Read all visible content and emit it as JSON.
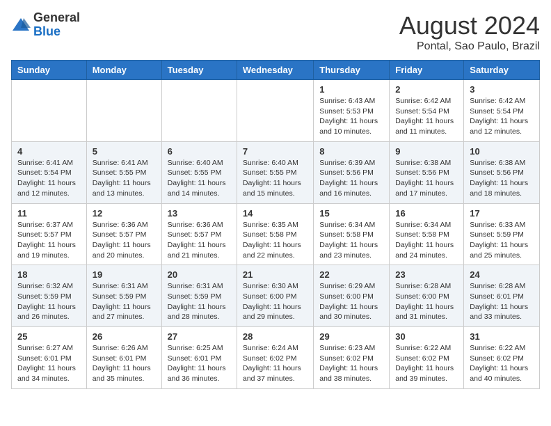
{
  "header": {
    "logo_general": "General",
    "logo_blue": "Blue",
    "month_title": "August 2024",
    "location": "Pontal, Sao Paulo, Brazil"
  },
  "days_of_week": [
    "Sunday",
    "Monday",
    "Tuesday",
    "Wednesday",
    "Thursday",
    "Friday",
    "Saturday"
  ],
  "weeks": [
    [
      {
        "day": "",
        "info": ""
      },
      {
        "day": "",
        "info": ""
      },
      {
        "day": "",
        "info": ""
      },
      {
        "day": "",
        "info": ""
      },
      {
        "day": "1",
        "info": "Sunrise: 6:43 AM\nSunset: 5:53 PM\nDaylight: 11 hours and 10 minutes."
      },
      {
        "day": "2",
        "info": "Sunrise: 6:42 AM\nSunset: 5:54 PM\nDaylight: 11 hours and 11 minutes."
      },
      {
        "day": "3",
        "info": "Sunrise: 6:42 AM\nSunset: 5:54 PM\nDaylight: 11 hours and 12 minutes."
      }
    ],
    [
      {
        "day": "4",
        "info": "Sunrise: 6:41 AM\nSunset: 5:54 PM\nDaylight: 11 hours and 12 minutes."
      },
      {
        "day": "5",
        "info": "Sunrise: 6:41 AM\nSunset: 5:55 PM\nDaylight: 11 hours and 13 minutes."
      },
      {
        "day": "6",
        "info": "Sunrise: 6:40 AM\nSunset: 5:55 PM\nDaylight: 11 hours and 14 minutes."
      },
      {
        "day": "7",
        "info": "Sunrise: 6:40 AM\nSunset: 5:55 PM\nDaylight: 11 hours and 15 minutes."
      },
      {
        "day": "8",
        "info": "Sunrise: 6:39 AM\nSunset: 5:56 PM\nDaylight: 11 hours and 16 minutes."
      },
      {
        "day": "9",
        "info": "Sunrise: 6:38 AM\nSunset: 5:56 PM\nDaylight: 11 hours and 17 minutes."
      },
      {
        "day": "10",
        "info": "Sunrise: 6:38 AM\nSunset: 5:56 PM\nDaylight: 11 hours and 18 minutes."
      }
    ],
    [
      {
        "day": "11",
        "info": "Sunrise: 6:37 AM\nSunset: 5:57 PM\nDaylight: 11 hours and 19 minutes."
      },
      {
        "day": "12",
        "info": "Sunrise: 6:36 AM\nSunset: 5:57 PM\nDaylight: 11 hours and 20 minutes."
      },
      {
        "day": "13",
        "info": "Sunrise: 6:36 AM\nSunset: 5:57 PM\nDaylight: 11 hours and 21 minutes."
      },
      {
        "day": "14",
        "info": "Sunrise: 6:35 AM\nSunset: 5:58 PM\nDaylight: 11 hours and 22 minutes."
      },
      {
        "day": "15",
        "info": "Sunrise: 6:34 AM\nSunset: 5:58 PM\nDaylight: 11 hours and 23 minutes."
      },
      {
        "day": "16",
        "info": "Sunrise: 6:34 AM\nSunset: 5:58 PM\nDaylight: 11 hours and 24 minutes."
      },
      {
        "day": "17",
        "info": "Sunrise: 6:33 AM\nSunset: 5:59 PM\nDaylight: 11 hours and 25 minutes."
      }
    ],
    [
      {
        "day": "18",
        "info": "Sunrise: 6:32 AM\nSunset: 5:59 PM\nDaylight: 11 hours and 26 minutes."
      },
      {
        "day": "19",
        "info": "Sunrise: 6:31 AM\nSunset: 5:59 PM\nDaylight: 11 hours and 27 minutes."
      },
      {
        "day": "20",
        "info": "Sunrise: 6:31 AM\nSunset: 5:59 PM\nDaylight: 11 hours and 28 minutes."
      },
      {
        "day": "21",
        "info": "Sunrise: 6:30 AM\nSunset: 6:00 PM\nDaylight: 11 hours and 29 minutes."
      },
      {
        "day": "22",
        "info": "Sunrise: 6:29 AM\nSunset: 6:00 PM\nDaylight: 11 hours and 30 minutes."
      },
      {
        "day": "23",
        "info": "Sunrise: 6:28 AM\nSunset: 6:00 PM\nDaylight: 11 hours and 31 minutes."
      },
      {
        "day": "24",
        "info": "Sunrise: 6:28 AM\nSunset: 6:01 PM\nDaylight: 11 hours and 33 minutes."
      }
    ],
    [
      {
        "day": "25",
        "info": "Sunrise: 6:27 AM\nSunset: 6:01 PM\nDaylight: 11 hours and 34 minutes."
      },
      {
        "day": "26",
        "info": "Sunrise: 6:26 AM\nSunset: 6:01 PM\nDaylight: 11 hours and 35 minutes."
      },
      {
        "day": "27",
        "info": "Sunrise: 6:25 AM\nSunset: 6:01 PM\nDaylight: 11 hours and 36 minutes."
      },
      {
        "day": "28",
        "info": "Sunrise: 6:24 AM\nSunset: 6:02 PM\nDaylight: 11 hours and 37 minutes."
      },
      {
        "day": "29",
        "info": "Sunrise: 6:23 AM\nSunset: 6:02 PM\nDaylight: 11 hours and 38 minutes."
      },
      {
        "day": "30",
        "info": "Sunrise: 6:22 AM\nSunset: 6:02 PM\nDaylight: 11 hours and 39 minutes."
      },
      {
        "day": "31",
        "info": "Sunrise: 6:22 AM\nSunset: 6:02 PM\nDaylight: 11 hours and 40 minutes."
      }
    ]
  ]
}
